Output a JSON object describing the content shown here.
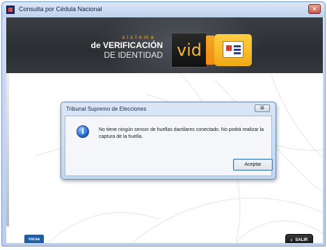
{
  "window": {
    "title": "Consulta por Cédula Nacional",
    "close_label": "✕",
    "app_icon": "app-icon"
  },
  "banner": {
    "sistema": "sistema",
    "line1": "de VERIFICACIÓN",
    "line2": "DE IDENTIDAD",
    "logo_text": "vid"
  },
  "dialog": {
    "title": "Tribunal Supremo de Elecciones",
    "close_label": "⊠",
    "icon": "info-icon",
    "message": "No tiene ningún sensor de huellas dactilares conectado. No podrá realizar la captura de la huella.",
    "accept_label": "Aceptar"
  },
  "footer": {
    "rocsa_label": "rocsa",
    "exit_label": "SALIR",
    "exit_icon": "chevron-left-icon"
  },
  "colors": {
    "banner_bg": "#2e3136",
    "accent_orange": "#f5a623",
    "dialog_bg": "#c9dbf1"
  }
}
